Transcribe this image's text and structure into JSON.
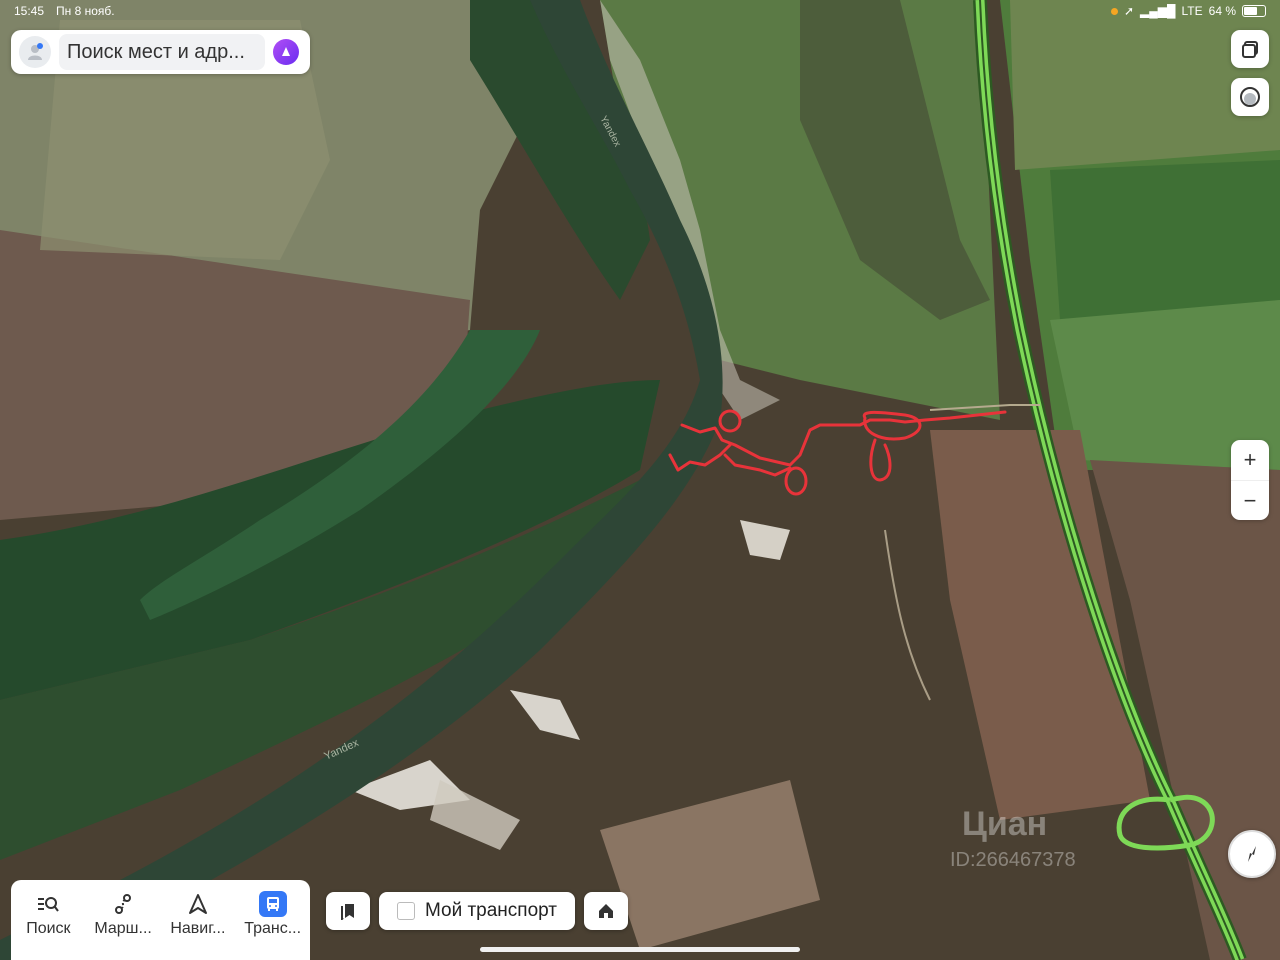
{
  "status": {
    "time": "15:45",
    "date": "Пн 8 нояб.",
    "network": "LTE",
    "battery": "64 %"
  },
  "search": {
    "placeholder": "Поиск мест и адр..."
  },
  "map": {
    "watermark_river_1": "Yandex",
    "watermark_river_2": "Yandex",
    "overlay_logo": "Циан",
    "overlay_id": "ID:266467378",
    "drawn_path_color": "#e8333a",
    "road_color": "#7ed957"
  },
  "controls": {
    "zoom_in": "+",
    "zoom_out": "−"
  },
  "tabbar": {
    "tabs": [
      {
        "label": "Поиск",
        "icon": "search-list-icon"
      },
      {
        "label": "Марш...",
        "icon": "route-icon"
      },
      {
        "label": "Навиг...",
        "icon": "navigator-icon"
      },
      {
        "label": "Транс...",
        "icon": "bus-icon",
        "active": true
      }
    ]
  },
  "bottom": {
    "my_transport": "Мой транспорт"
  }
}
